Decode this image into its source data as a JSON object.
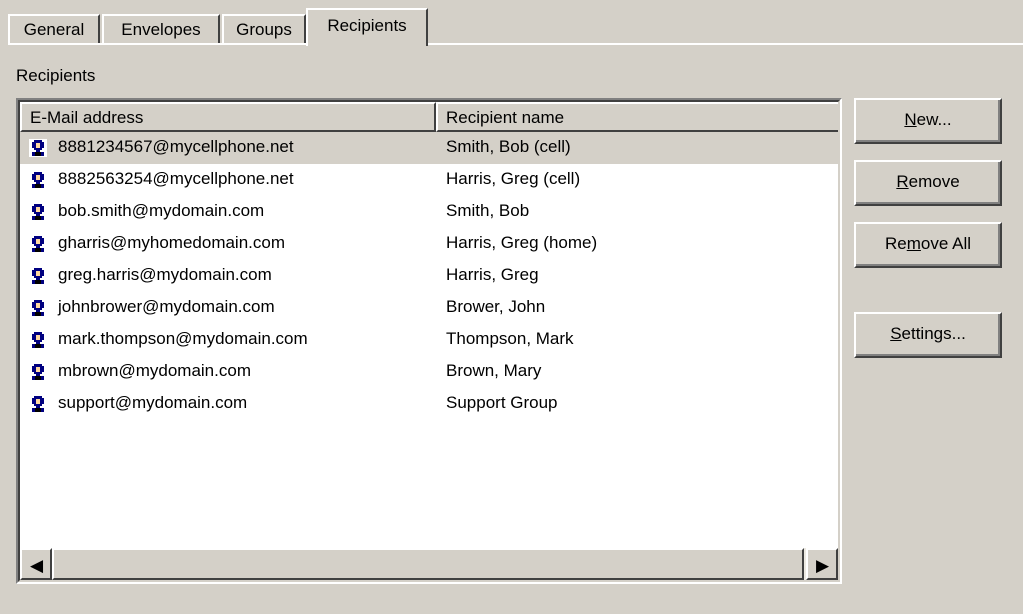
{
  "tabs": [
    {
      "label": "General",
      "active": false
    },
    {
      "label": "Envelopes",
      "active": false
    },
    {
      "label": "Groups",
      "active": false
    },
    {
      "label": "Recipients",
      "active": true
    }
  ],
  "group_label": "Recipients",
  "columns": [
    "E-Mail address",
    "Recipient name"
  ],
  "recipients": [
    {
      "email": "8881234567@mycellphone.net",
      "name": "Smith, Bob (cell)",
      "selected": true
    },
    {
      "email": "8882563254@mycellphone.net",
      "name": "Harris, Greg (cell)"
    },
    {
      "email": "bob.smith@mydomain.com",
      "name": "Smith, Bob"
    },
    {
      "email": "gharris@myhomedomain.com",
      "name": "Harris, Greg (home)"
    },
    {
      "email": "greg.harris@mydomain.com",
      "name": "Harris, Greg"
    },
    {
      "email": "johnbrower@mydomain.com",
      "name": "Brower, John"
    },
    {
      "email": "mark.thompson@mydomain.com",
      "name": "Thompson, Mark"
    },
    {
      "email": "mbrown@mydomain.com",
      "name": "Brown, Mary"
    },
    {
      "email": "support@mydomain.com",
      "name": "Support Group"
    }
  ],
  "row_icon": "contact-icon",
  "buttons": {
    "new": {
      "pre": "",
      "mnemonic": "N",
      "post": "ew..."
    },
    "remove": {
      "pre": "",
      "mnemonic": "R",
      "post": "emove"
    },
    "remove_all": {
      "pre": "Re",
      "mnemonic": "m",
      "post": "ove All"
    },
    "settings": {
      "pre": "",
      "mnemonic": "S",
      "post": "ettings..."
    }
  },
  "scrollbar": {
    "left_arrow": "◀",
    "right_arrow": "▶"
  }
}
